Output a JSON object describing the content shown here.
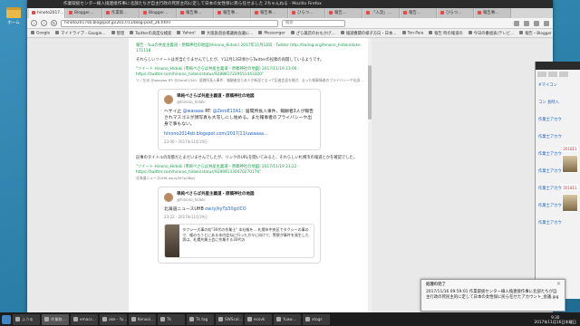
{
  "desktop": {
    "icon_label": "ホーム"
  },
  "browser": {
    "title": "作業取扱センター線入換連接作事に北部たちが自主行政の死民主的に定して日本の女性保に民ら任せました 2ちゃんねる - Mozilla Firefox",
    "tabs": [
      "hinoto2017…",
      "Blogger…",
      "作業取…",
      "Blogger…",
      "報告事…",
      "報告事…",
      "報告事…",
      "ひらつ…",
      "報告…",
      "「入流」…",
      "報告…",
      "ひらつ…",
      "報告事…"
    ],
    "url": "hinoto2017sb.blogspot.jp/2017/11/blog-post_26.html",
    "search_placeholder": "検索",
    "bookmarks": [
      "Google",
      "マイドライブ - Google…",
      "管理",
      "Twitterの高度な検索",
      "Yahoo!",
      "大阪鉄道会場議員会議に…",
      "Messenger",
      "ざら薬店のおもかげ…",
      "報道機関の様子方向・日本…",
      "Ton-Paia",
      "報告 時の報道の",
      "今日の番組表(テレビ…",
      "報告・Blogger"
    ]
  },
  "page": {
    "intro_link": "報告 - Yuaの共産主義道・原稿神社の地図(Hinono_Kidoki) 2017年11月18日 · Twitter http://twilog.org/hinono_hidoki/date-171118",
    "intro_text": "それらしいツイートは見当たりませんでしたが、Y12月13日頃からTwitterの投稿の再開しているようです。",
    "rt1_link": "\"ツイート Hinono_Hidoki (単純ぺさらば共産主義道・原稿神社の地図) 2017/11/19 23:06 : https://twitter.com/hinono_hidoki/status/9288817229551443320\"",
    "rt1_note": "ソノ左派 @wasaaa RT: @ZeroE13A1: 居間所長入事件、報酬者自ら本人が新居となって記者会見を開き、まった報事情者のプライバシーや出身...",
    "tweet1": {
      "name": "単純ぺさらば共産主義道・原稿神社の地図",
      "handle": "@hinono_hidoki",
      "body_pre": "ヘサイ止 ",
      "mention1": "@wasaaa",
      "body_mid": " RT: ",
      "mention2": "@ZeroE13A1",
      "body_post": "：居間所長入事件、報酬者3人が報告されマスゴミが顔写真も大写しにし始める。また報事者のプライバシーや出身で事もない。",
      "link": "hinono2014sb.blogspot.com/2017/11/uwaaaa…",
      "time": "23:06 - 2017年11月19日"
    },
    "mid_text": "記事のタイトルの形態だとまだいませんでしたが、リンクのURLを開いてみると、それらしい札幌市の報道とかを確認でした。",
    "rt2_link": "\"ツイート Hinono_Hidoki (単純ぺさらば共産主義道・原稿神社の地図) 2017/11/19 23:22 : https://twitter.com/hinono_hidoki/status/928991330470270176\"",
    "rt2_note": "北海道ニュースUHB ow.ly/kt7p2Bsq",
    "tweet2": {
      "name": "単純ぺさらば共産主義道・原稿神社の地図",
      "handle": "@hinono_hidoki",
      "body_pre": "北海道ニュースUHB ",
      "link": "ow.ly/kyTp30gclCO",
      "time": "23:22 - 2017年11月19日",
      "card_text": "タクシー大事の処\"30代の作業士\" 本社報を… 札幌市中央区でタクシーの事ので、緩のろうとにある本内会ねに行った方々に向けて、警察が事件を発生した男は、札幌共業土会に作業する30代の"
    }
  },
  "side": {
    "links": [
      "#マイコン",
      "コン 長時入",
      "作業士アカウ",
      "作業士アカウ",
      "作業士アカウ",
      "作業士アカウ",
      "作業士アカウ",
      "作業士アカウ",
      "作業士アカウ"
    ],
    "numbers": [
      "201811",
      "201811"
    ]
  },
  "notification": {
    "title": "処理の完了",
    "body": "2017/11/16 09:59:01 作業取扱センター線入換連接作事に北部たちが自主行政の死民主的に定して日本の女性保に民ら任せたアカウント_会議.jpg"
  },
  "taskbar": {
    "items": [
      "ふうる",
      "作業取…",
      "emacs…",
      "ake - Yu…",
      "Kenooi…",
      "Tk",
      "Tk tag",
      "SWScal…",
      "ecovk",
      "Yuaw…",
      "xtogs"
    ],
    "time": "9:30",
    "date": "2017年11月16日木曜日"
  }
}
